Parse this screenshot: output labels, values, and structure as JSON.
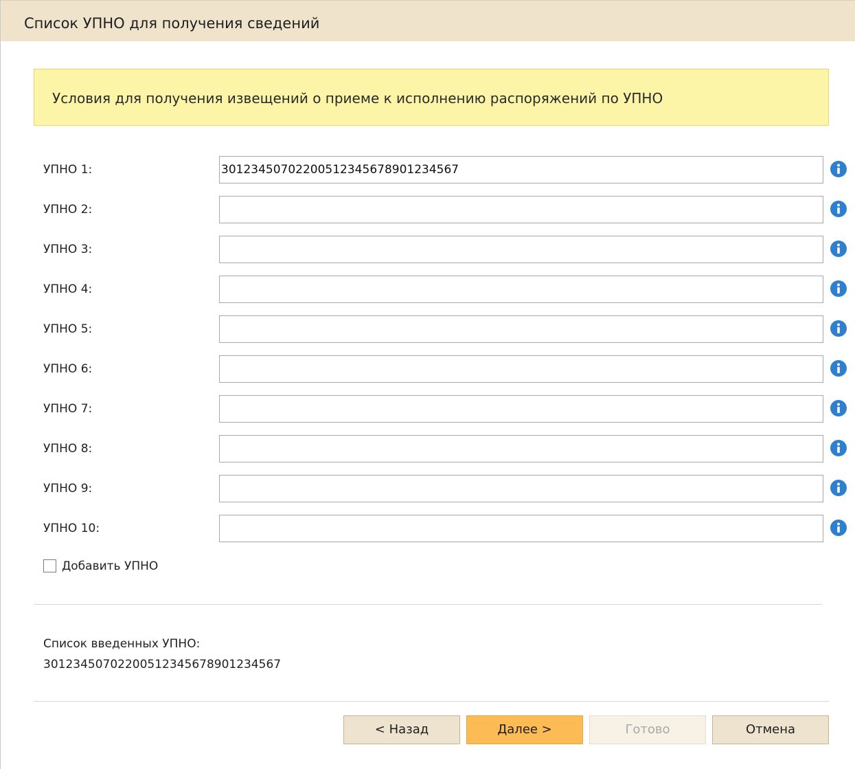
{
  "window": {
    "title": "Список УПНО для получения сведений"
  },
  "notice": {
    "text": "Условия для получения извещений о приеме к исполнению распоряжений по УПНО"
  },
  "fields": [
    {
      "label": "УПНО 1:",
      "value": "30123450702200512345678901234567"
    },
    {
      "label": "УПНО 2:",
      "value": ""
    },
    {
      "label": "УПНО 3:",
      "value": ""
    },
    {
      "label": "УПНО 4:",
      "value": ""
    },
    {
      "label": "УПНО 5:",
      "value": ""
    },
    {
      "label": "УПНО 6:",
      "value": ""
    },
    {
      "label": "УПНО 7:",
      "value": ""
    },
    {
      "label": "УПНО 8:",
      "value": ""
    },
    {
      "label": "УПНО 9:",
      "value": ""
    },
    {
      "label": "УПНО 10:",
      "value": ""
    }
  ],
  "field_icon": "info-icon",
  "add_checkbox": {
    "label": "Добавить УПНО",
    "checked": false
  },
  "summary": {
    "label": "Список введенных УПНО:",
    "value": "30123450702200512345678901234567"
  },
  "buttons": {
    "back": "< Назад",
    "next": "Далее >",
    "done": "Готово",
    "cancel": "Отмена"
  },
  "colors": {
    "title_bar": "#efe3cc",
    "notice_bg": "#fcf5a8",
    "primary_button": "#fdbb55",
    "button_bg": "#eee3cf",
    "info_icon": "#2d7fd0"
  }
}
